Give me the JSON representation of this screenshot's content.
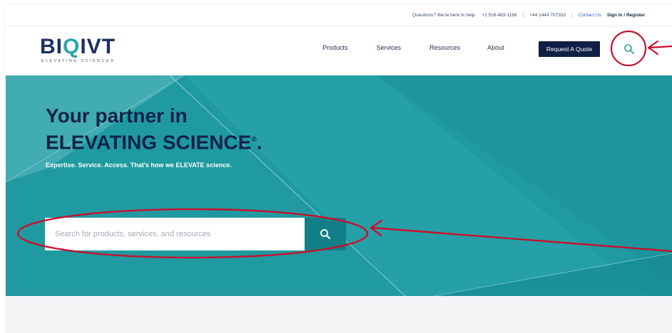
{
  "utility": {
    "help_text": "Questions? We're here to help:",
    "phone_us": "+1 516-483-1196",
    "phone_uk": "+44 1444 707333",
    "contact": "Contact Us",
    "signin": "Sign In / Register"
  },
  "logo": {
    "mark_a": "BI",
    "mark_b": "Q",
    "mark_c": "IVT",
    "tagline": "ELEVATING SCIENCE®"
  },
  "nav": {
    "items": [
      "Products",
      "Services",
      "Resources",
      "About"
    ],
    "quote_button": "Request A Quote"
  },
  "hero": {
    "title_line1": "Your partner in",
    "title_line2": "ELEVATING SCIENCE",
    "title_reg": "®",
    "title_period": ".",
    "subtitle": "Expertise. Service. Access. That's how we ELEVATE science.",
    "search_placeholder": "Search for products, services, and resources"
  },
  "colors": {
    "navy": "#0f1f45",
    "teal": "#1f9aa0",
    "teal_dark": "#127f86",
    "annotation_red": "#c8102e"
  },
  "icons": {
    "header_search": "search-icon",
    "hero_search": "search-icon"
  }
}
